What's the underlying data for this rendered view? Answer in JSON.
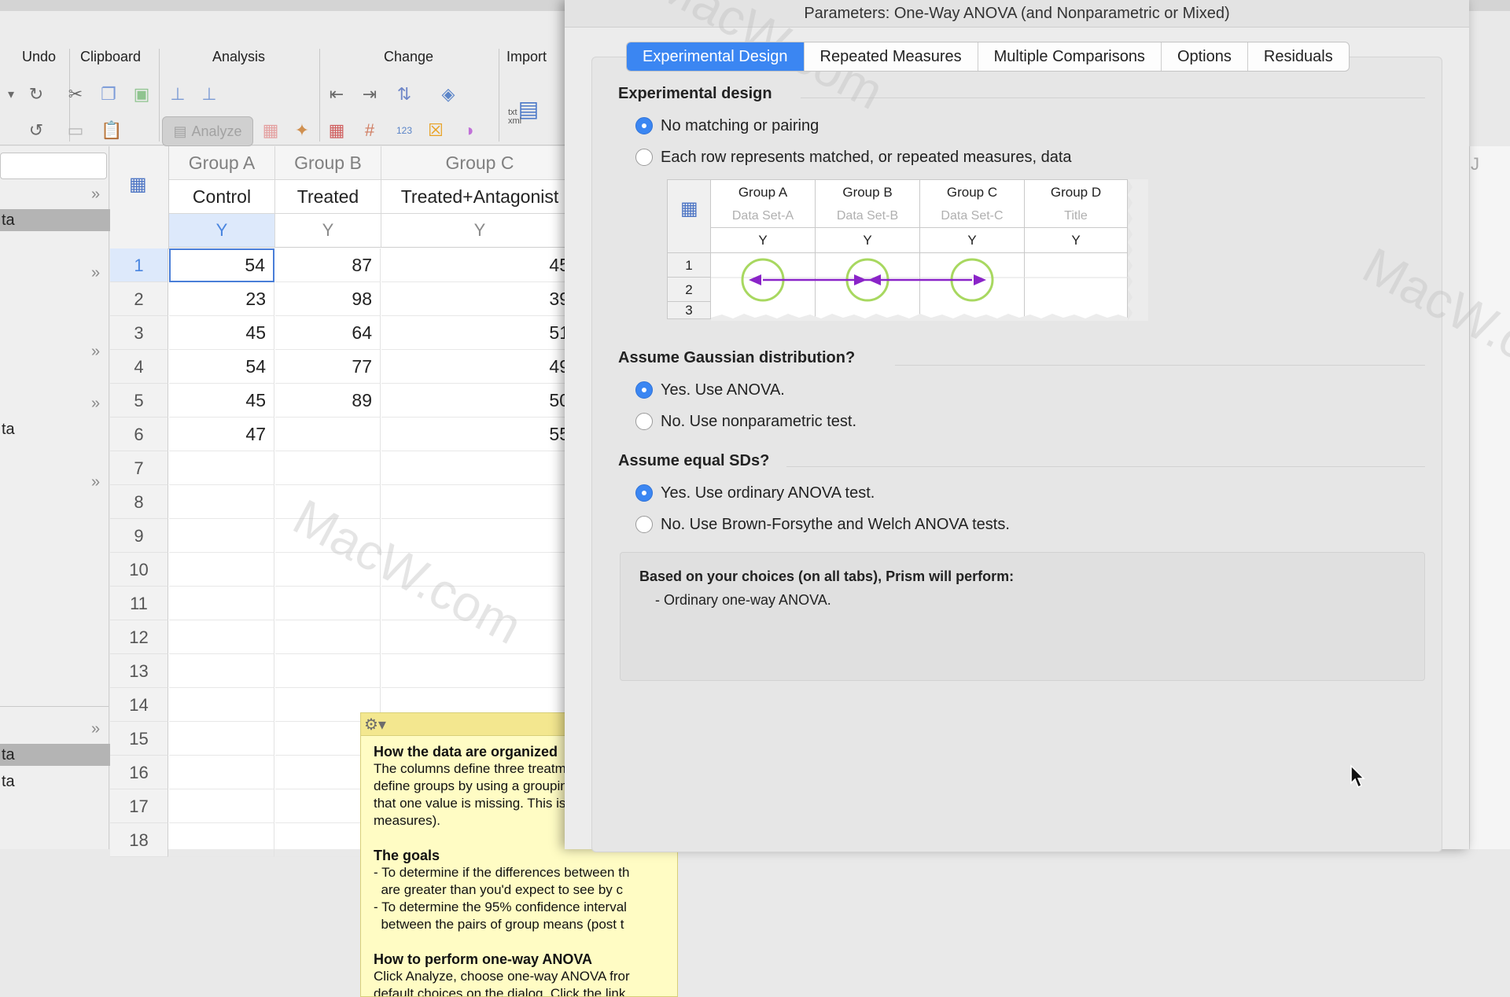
{
  "toolbar": {
    "groups": {
      "undo": "Undo",
      "clipboard": "Clipboard",
      "analysis": "Analysis",
      "change": "Change",
      "import": "Import"
    },
    "analyze_button": "Analyze",
    "import_icon_text": "txt\nxml",
    "sort_badge": "123"
  },
  "navigator": {
    "items": [
      "ta",
      "ta",
      "ta",
      "ta"
    ]
  },
  "datasheet": {
    "columns": [
      {
        "header": "Group A",
        "title": "Control",
        "sub": "Y"
      },
      {
        "header": "Group B",
        "title": "Treated",
        "sub": "Y"
      },
      {
        "header": "Group C",
        "title": "Treated+Antagonist",
        "sub": "Y"
      }
    ],
    "rows": [
      {
        "num": "1",
        "a": "54",
        "b": "87",
        "c": "45"
      },
      {
        "num": "2",
        "a": "23",
        "b": "98",
        "c": "39"
      },
      {
        "num": "3",
        "a": "45",
        "b": "64",
        "c": "51"
      },
      {
        "num": "4",
        "a": "54",
        "b": "77",
        "c": "49"
      },
      {
        "num": "5",
        "a": "45",
        "b": "89",
        "c": "50"
      },
      {
        "num": "6",
        "a": "47",
        "b": "",
        "c": "55"
      },
      {
        "num": "7",
        "a": "",
        "b": "",
        "c": ""
      },
      {
        "num": "8",
        "a": "",
        "b": "",
        "c": ""
      },
      {
        "num": "9",
        "a": "",
        "b": "",
        "c": ""
      },
      {
        "num": "10",
        "a": "",
        "b": "",
        "c": ""
      },
      {
        "num": "11",
        "a": "",
        "b": "",
        "c": ""
      },
      {
        "num": "12",
        "a": "",
        "b": "",
        "c": ""
      },
      {
        "num": "13",
        "a": "",
        "b": "",
        "c": ""
      },
      {
        "num": "14",
        "a": "",
        "b": "",
        "c": ""
      },
      {
        "num": "15",
        "a": "",
        "b": "",
        "c": ""
      },
      {
        "num": "16",
        "a": "",
        "b": "",
        "c": ""
      },
      {
        "num": "17",
        "a": "",
        "b": "",
        "c": ""
      },
      {
        "num": "18",
        "a": "",
        "b": "",
        "c": ""
      }
    ],
    "right_column_letter": "J"
  },
  "info_note": {
    "heading1": "How the data are organized",
    "p1_l1": "The columns define three treatments. Note",
    "p1_l2": "define groups by using a grouping variable.",
    "p1_l3": "that one value is missing. This is fine for or",
    "p1_l4": "measures).",
    "heading2": "The goals",
    "g1_l1": "- To determine if the differences between th",
    "g1_l2": "  are greater than you'd expect to see by c",
    "g2_l1": "- To determine the 95% confidence interval",
    "g2_l2": "  between the pairs of group means (post t",
    "heading3": "How to perform one-way ANOVA",
    "p3_l1": "Click  Analyze, choose one-way ANOVA fror",
    "p3_l2": "default choices on the dialog. Click the link"
  },
  "dialog": {
    "title": "Parameters: One-Way ANOVA (and Nonparametric or Mixed)",
    "tabs": [
      {
        "label": "Experimental Design",
        "active": true
      },
      {
        "label": "Repeated Measures",
        "active": false
      },
      {
        "label": "Multiple Comparisons",
        "active": false
      },
      {
        "label": "Options",
        "active": false
      },
      {
        "label": "Residuals",
        "active": false
      }
    ],
    "experimental_design": {
      "heading": "Experimental design",
      "opt1": "No matching or pairing",
      "opt2": "Each row represents matched, or repeated measures, data",
      "selected": "opt1"
    },
    "diagram": {
      "headers": [
        "Group A",
        "Group B",
        "Group C",
        "Group D"
      ],
      "sets": [
        "Data Set-A",
        "Data Set-B",
        "Data Set-C",
        "Title"
      ],
      "ys": [
        "Y",
        "Y",
        "Y",
        "Y"
      ],
      "rows": [
        "1",
        "2",
        "3"
      ]
    },
    "gaussian": {
      "heading": "Assume Gaussian distribution?",
      "yes": "Yes. Use ANOVA.",
      "no": "No. Use nonparametric test.",
      "selected": "yes"
    },
    "equal_sds": {
      "heading": "Assume equal SDs?",
      "yes": "Yes. Use ordinary ANOVA test.",
      "no": "No. Use Brown-Forsythe and Welch ANOVA tests.",
      "selected": "yes"
    },
    "summary": {
      "heading": "Based on your choices (on all tabs), Prism will perform:",
      "line": "- Ordinary one-way ANOVA."
    }
  },
  "watermark": "MacW.com",
  "colors": {
    "accent": "#3b86f2",
    "diagram_circle": "#a8d860",
    "diagram_arrow": "#8a24c8",
    "note_bg": "#fffcc4"
  }
}
